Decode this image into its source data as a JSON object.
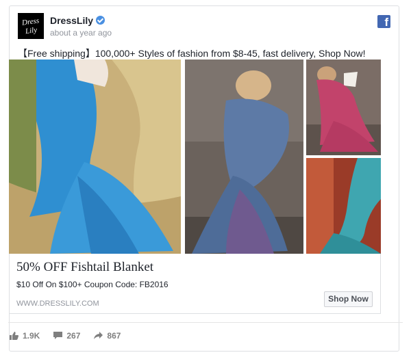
{
  "post": {
    "page_name": "DressLily",
    "avatar_text": "Dress Lily",
    "timestamp": "about a year ago",
    "text": "【Free shipping】100,000+ Styles of fashion from $8-45, fast delivery, Shop Now!"
  },
  "link": {
    "title": "50% OFF Fishtail Blanket",
    "description": "$10 Off On $100+ Coupon Code: FB2016",
    "domain": "WWW.DRESSLILY.COM",
    "cta_label": "Shop Now"
  },
  "stats": {
    "likes": "1.9K",
    "comments": "267",
    "shares": "867"
  },
  "icons": {
    "verified": "verified-badge-icon",
    "facebook": "facebook-icon",
    "like": "thumbs-up-icon",
    "comment": "comment-icon",
    "share": "share-arrow-icon"
  },
  "colors": {
    "facebook_blue": "#4267b2",
    "verified_blue": "#4a90e2",
    "muted_text": "#90949c",
    "border": "#dddfe2"
  }
}
